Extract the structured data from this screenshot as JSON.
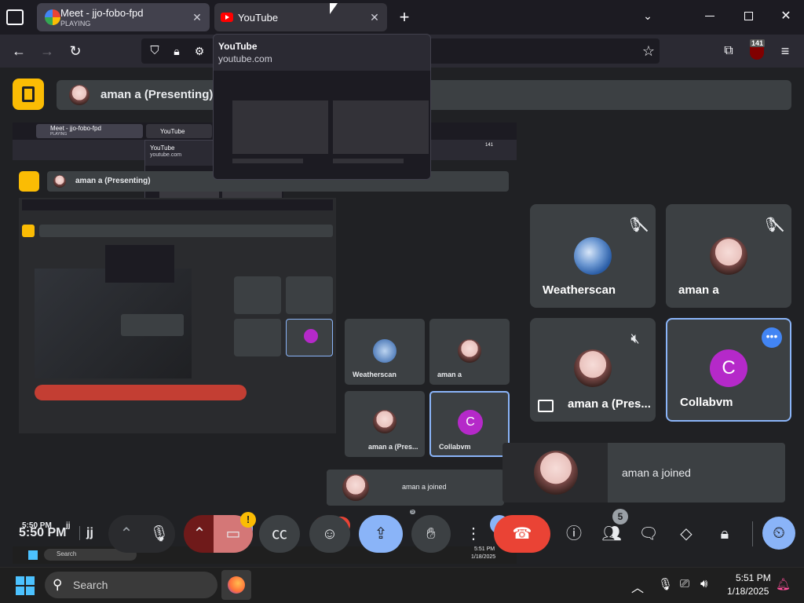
{
  "browser": {
    "tabs": [
      {
        "title": "Meet - jjo-fobo-fpd",
        "subtitle": "PLAYING",
        "active": true
      },
      {
        "title": "YouTube",
        "subtitle": "",
        "active": false
      }
    ],
    "preview": {
      "title": "YouTube",
      "url": "youtube.com"
    },
    "notification_badge": "141"
  },
  "meet": {
    "presenter_label": "aman a (Presenting)",
    "participants": [
      {
        "name": "Weatherscan",
        "muted": true
      },
      {
        "name": "aman a",
        "muted": true
      },
      {
        "name": "aman a (Pres...",
        "muted": true
      },
      {
        "name": "Collabvm",
        "initial": "C"
      }
    ],
    "toast": "aman a joined",
    "time": "5:50 PM",
    "meeting_code": "jj",
    "people_count": "5",
    "warning_badge": "!"
  },
  "taskbar": {
    "search_placeholder": "Search",
    "time": "5:51 PM",
    "date": "1/18/2025"
  },
  "nested": {
    "tab1": "Meet - jjo-fobo-fpd",
    "tab1_sub": "PLAYING",
    "tab2": "YouTube",
    "preview_title": "YouTube",
    "preview_url": "youtube.com",
    "presenter_label": "aman a (Presenting)",
    "tiles": [
      "Weatherscan",
      "aman a",
      "aman a (Pres...",
      "Collabvm"
    ],
    "toast": "aman a joined",
    "time": "5:50 PM",
    "code": "jj",
    "people_count": "5",
    "badge": "141",
    "search": "Search",
    "tb_time": "5:51 PM",
    "tb_date": "1/18/2025"
  },
  "colors": {
    "accent_blue": "#8ab4f8",
    "end_call": "#ea4335",
    "collab_purple": "#b529c9",
    "meet_yellow": "#fbbc04"
  }
}
